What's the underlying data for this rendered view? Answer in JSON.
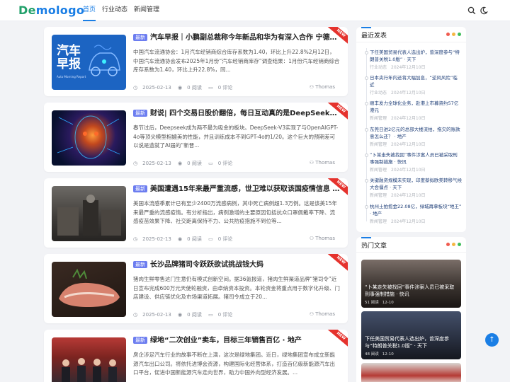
{
  "header": {
    "logo_part1": "De",
    "logo_part2": "mologo",
    "nav": [
      "首页",
      "行业动态",
      "新闻管理"
    ],
    "icons": [
      "search-icon",
      "theme-toggle-icon"
    ]
  },
  "colors": {
    "accent": "#1a7ee5",
    "logo_green": "#21a06a",
    "tag": "#6c7df0",
    "ribbon": "#e5322d"
  },
  "articles": [
    {
      "tag": "最新",
      "title": "汽车早报｜小鹏副总裁称今年新品和华为有深入合作 宁德时代动力...",
      "desc": "中国汽车流通协会：1月汽车经销商综合库存系数为1.40，环比上升22.8%2月12日，中国汽车流通协会发布2025年1月份“汽车经销商库存”调查结果：1月份汽车经销商综合库存系数为1.40，环比上升22.8%，同...",
      "date": "2025-02-13",
      "views": "0 阅读",
      "comments": "0 评论",
      "author": "Thomas",
      "thumb_line1": "汽车",
      "thumb_line2": "早报",
      "thumb_sub": "Auto Morning Report",
      "ribbon": "NEW"
    },
    {
      "tag": "最新",
      "title": "财说| 四个交易日股价翻倍，每日互动真的是DeepSeek最直接关联...",
      "desc": "春节过后，Deepseek成为两不最为吸金的板块。DeepSeek-V3实现了与OpenAIGPT-4o等顶尖模型相媲美的性能，并且训练成本不到GPT-4o的1/20。这个巨大的预期差可以说是造就了AI届的“新晋...",
      "date": "2025-02-13",
      "views": "0 阅读",
      "comments": "0 评论",
      "author": "Thomas",
      "ribbon": "NEW"
    },
    {
      "tag": "最新",
      "title": "美国遭遇15年来最严重流感，世卫难以获取该国疫情信息 · 天下",
      "desc": "美国本流感季累计已有至少2400万流感病例，其中死亡病例超1.3万例。这是该美15年来最严重的流感疫情。有分析指出，病例激增的主要原因包括抗众口罩佩戴率下降、流感疫苗效果下降、社交距离保持不力、公共防疫措施不到位等...",
      "date": "2025-02-13",
      "views": "0 阅读",
      "comments": "0 评论",
      "author": "Thomas",
      "ribbon": "NEW"
    },
    {
      "tag": "最新",
      "title": "长沙品牌猪司令跃跃欲试挑战钱大妈",
      "desc": "猪肉生鲜零售这门生意仍有模式创新空间。据36氪报道，猪肉生鲜渠道品牌“猪司令”近日宣布完成600万元天使轮融资，由卓纳资本投资。本轮资金将重点用于数字化升级、门店建设、供应链优化及市场渠道拓展。猪司令成立于20...",
      "date": "2025-02-13",
      "views": "0 阅读",
      "comments": "0 评论",
      "author": "Thomas",
      "ribbon": "NEW"
    },
    {
      "tag": "最新",
      "title": "绿地“二次创业”卖车，目标三年销售百亿 · 地产",
      "desc": "房企涉足汽车行业的故事不断在上演，这次是绿地集团。近日，绿地集团宣布成立新能源汽车出口公司。将依托进博会资源，构建国际化经营体系，打造百亿级新能源汽车出口平台，促进中国新能源汽车走向世界，助力中国外向型经济发展。...",
      "date": "2025-02-13",
      "views": "0 阅读",
      "comments": "0 评论",
      "author": "Thomas",
      "ribbon": "NEW"
    }
  ],
  "sidebar": {
    "recent_title": "最近发表",
    "recent": [
      {
        "title": "下任美国贸易代表人选出炉，曾深度参与“特朗普关税1.0版” · 天下",
        "cat": "行业动态",
        "date": "2024年12月10日"
      },
      {
        "title": "日本央行年内还将大幅加息，“逆风风险”临近",
        "cat": "行业动态",
        "date": "2024年12月10日"
      },
      {
        "title": "顺丰发力全球化业务，赴港上市募资约57亿港元",
        "cat": "新闻管理",
        "date": "2024年12月10日"
      },
      {
        "title": "东莞日进2亿元的总部大楼流拍，拖欠的账款意怎么还？ · 地产",
        "cat": "新闻管理",
        "date": "2024年12月10日"
      },
      {
        "title": "“卜某走失被找回”事件涉案人员已被采取刑事强制措施 · 快讯",
        "cat": "新闻管理",
        "date": "2024年12月10日"
      },
      {
        "title": "关键融资规模未实现，印度蔡拟欧美转移气候大会僵点 · 天下",
        "cat": "新闻管理",
        "date": "2024年12月10日"
      },
      {
        "title": "杭州土拍揽金22.08亿，绿城再拿板块“地王” · 地产",
        "cat": "新闻管理",
        "date": "2024年12月10日"
      }
    ],
    "hot_title": "热门文章",
    "hot": [
      {
        "title": "“卜某走失被找回”事件涉案人员已被采取刑事强制措施 · 快讯",
        "views": "51 阅读",
        "date": "12-10"
      },
      {
        "title": "下任美国贸易代表人选出炉，曾深度参与“特朗普关税1.0版” · 天下",
        "views": "48 阅读",
        "date": "12-10"
      }
    ]
  }
}
